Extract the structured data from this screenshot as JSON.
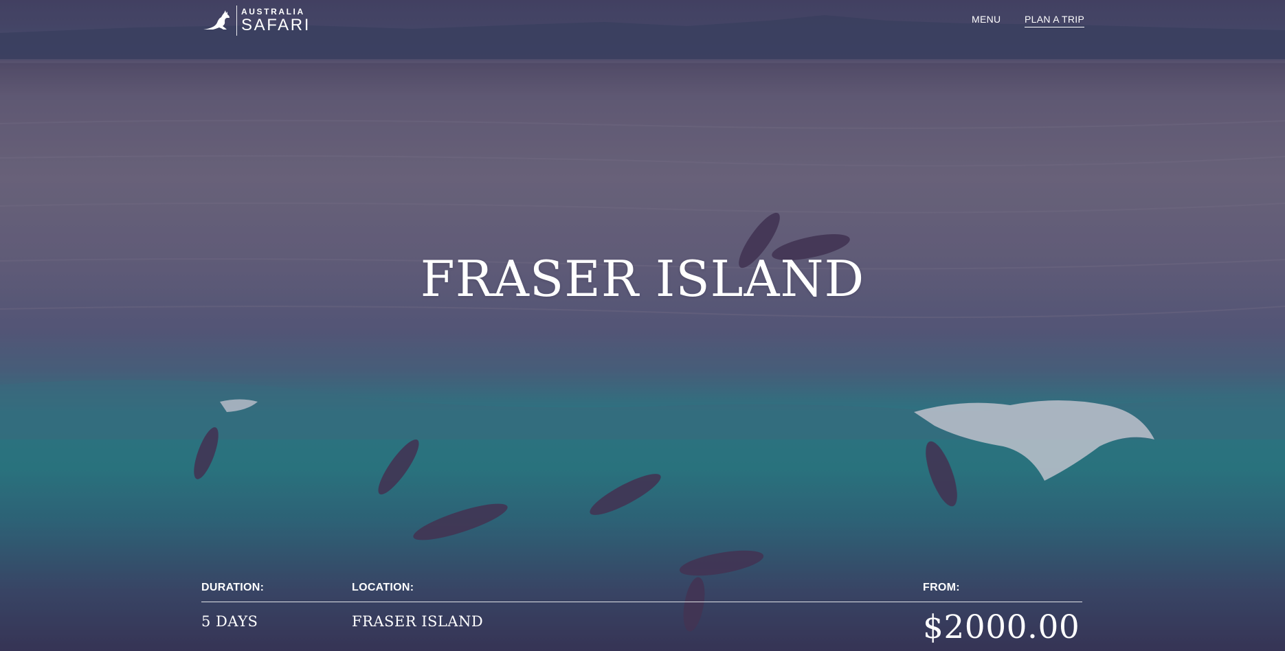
{
  "brand": {
    "line1": "AUSTRALIA",
    "line2": "SAFARI"
  },
  "nav": {
    "menu": "MENU",
    "plan": "PLAN A TRIP"
  },
  "hero": {
    "title": "FRASER ISLAND"
  },
  "info": {
    "duration_label": "DURATION:",
    "duration_value": "5 DAYS",
    "location_label": "LOCATION:",
    "location_value": "FRASER ISLAND",
    "price_label": "FROM:",
    "price_value": "$2000.00"
  }
}
